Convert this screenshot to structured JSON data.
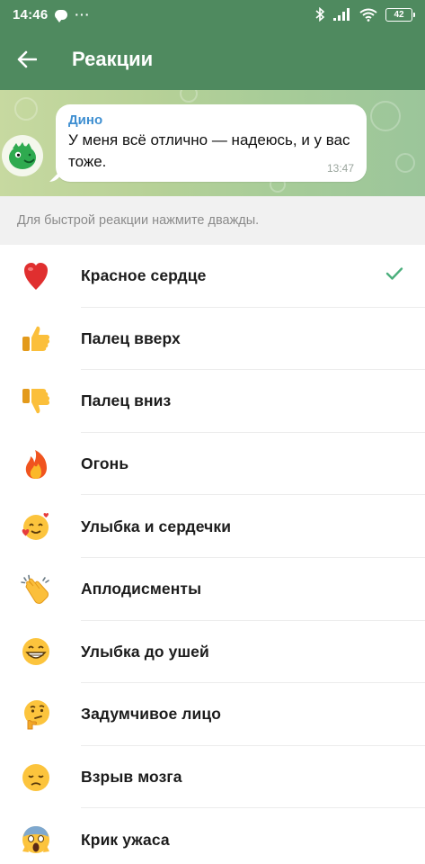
{
  "status_bar": {
    "time": "14:46",
    "dots": "···",
    "battery": "42"
  },
  "toolbar": {
    "title": "Реакции"
  },
  "preview": {
    "sender": "Дино",
    "message": "У меня всё отлично — надеюсь, и у вас тоже.",
    "time": "13:47"
  },
  "hint": "Для быстрой реакции нажмите дважды.",
  "reactions": [
    {
      "label": "Красное сердце",
      "icon": "red-heart-icon",
      "selected": true
    },
    {
      "label": "Палец вверх",
      "icon": "thumbs-up-icon",
      "selected": false
    },
    {
      "label": "Палец вниз",
      "icon": "thumbs-down-icon",
      "selected": false
    },
    {
      "label": "Огонь",
      "icon": "fire-icon",
      "selected": false
    },
    {
      "label": "Улыбка и сердечки",
      "icon": "smiling-face-with-hearts-icon",
      "selected": false
    },
    {
      "label": "Аплодисменты",
      "icon": "clapping-hands-icon",
      "selected": false
    },
    {
      "label": "Улыбка до ушей",
      "icon": "grinning-face-icon",
      "selected": false
    },
    {
      "label": "Задумчивое лицо",
      "icon": "thinking-face-icon",
      "selected": false
    },
    {
      "label": "Взрыв мозга",
      "icon": "disappointed-face-icon",
      "selected": false
    },
    {
      "label": "Крик ужаса",
      "icon": "screaming-face-icon",
      "selected": false
    }
  ],
  "colors": {
    "header_green": "#4f8a5f",
    "check_green": "#4caf7d",
    "sender_blue": "#3f8fd1"
  }
}
